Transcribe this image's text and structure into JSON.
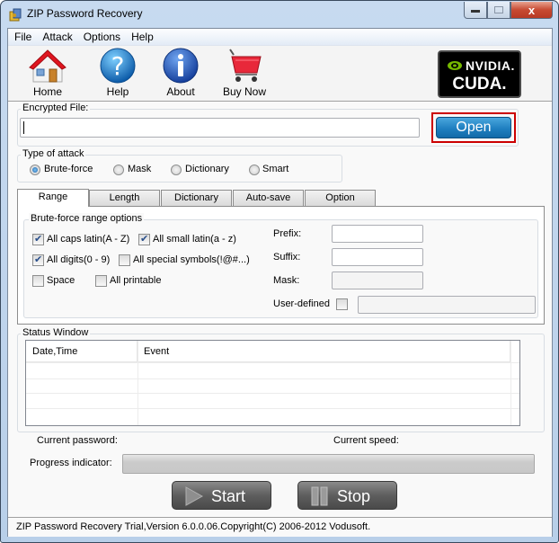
{
  "window": {
    "title": "ZIP Password Recovery",
    "controls": {
      "minimize": "minimize",
      "maximize": "maximize",
      "close": "x"
    }
  },
  "menu": {
    "items": [
      {
        "label": "File"
      },
      {
        "label": "Attack"
      },
      {
        "label": "Options"
      },
      {
        "label": "Help"
      }
    ]
  },
  "toolbar": {
    "buttons": [
      {
        "label": "Home",
        "icon": "home-icon"
      },
      {
        "label": "Help",
        "icon": "help-icon"
      },
      {
        "label": "About",
        "icon": "info-icon"
      },
      {
        "label": "Buy Now",
        "icon": "cart-icon"
      }
    ],
    "badge": {
      "brand": "NVIDIA.",
      "product": "CUDA."
    }
  },
  "encrypted_file": {
    "label": "Encrypted File:",
    "value": "",
    "open_label": "Open"
  },
  "attack_type": {
    "label": "Type of attack",
    "options": [
      {
        "label": "Brute-force",
        "selected": true
      },
      {
        "label": "Mask",
        "selected": false
      },
      {
        "label": "Dictionary",
        "selected": false
      },
      {
        "label": "Smart",
        "selected": false
      }
    ]
  },
  "tabs": [
    {
      "label": "Range",
      "active": true
    },
    {
      "label": "Length",
      "active": false
    },
    {
      "label": "Dictionary",
      "active": false
    },
    {
      "label": "Auto-save",
      "active": false
    },
    {
      "label": "Option",
      "active": false
    }
  ],
  "range": {
    "group_label": "Brute-force range options",
    "checkboxes": [
      {
        "label": "All caps latin(A - Z)",
        "checked": true
      },
      {
        "label": "All small latin(a - z)",
        "checked": true
      },
      {
        "label": "All digits(0 - 9)",
        "checked": true
      },
      {
        "label": "All special symbols(!@#...)",
        "checked": false
      },
      {
        "label": "Space",
        "checked": false
      },
      {
        "label": "All printable",
        "checked": false
      }
    ],
    "prefix": {
      "label": "Prefix:",
      "value": ""
    },
    "suffix": {
      "label": "Suffix:",
      "value": ""
    },
    "mask": {
      "label": "Mask:",
      "value": ""
    },
    "user_defined": {
      "label": "User-defined",
      "checked": false,
      "value": ""
    }
  },
  "status_window": {
    "label": "Status Window",
    "columns": [
      "Date,Time",
      "Event"
    ],
    "rows": []
  },
  "progress": {
    "current_password_label": "Current password:",
    "current_password": "",
    "current_speed_label": "Current speed:",
    "current_speed": "",
    "indicator_label": "Progress indicator:",
    "percent": 0
  },
  "actions": {
    "start_label": "Start",
    "stop_label": "Stop"
  },
  "statusbar": {
    "text": "ZIP Password Recovery Trial,Version 6.0.0.06.Copyright(C) 2006-2012 Vodusoft."
  }
}
